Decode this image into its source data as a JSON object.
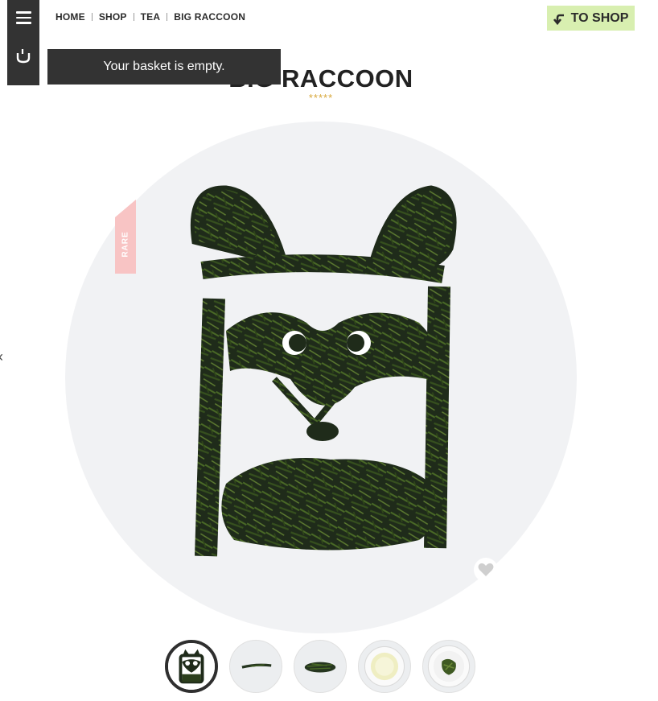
{
  "sidebar": {
    "menu_icon": "hamburger-icon",
    "basket_icon": "cup-icon"
  },
  "basket": {
    "message": "Your basket is empty."
  },
  "breadcrumb": {
    "home": "HOME",
    "shop": "SHOP",
    "tea": "TEA",
    "current": "BIG RACCOON"
  },
  "to_shop": {
    "label": "TO SHOP",
    "icon": "return-arrow-icon",
    "color": "#d8efb0"
  },
  "product": {
    "title": "BIG RACCOON",
    "rating_stars": "*****",
    "rating_color": "#d8a83b",
    "badge": "RARE",
    "badge_color": "#f8c4c4"
  },
  "colors": {
    "sidebar": "#333333",
    "leaf_dark": "#1f2b1a",
    "leaf_mid": "#3f5a23",
    "hero_bg": "#f1f2f4"
  },
  "thumbnails": [
    {
      "name": "raccoon-art"
    },
    {
      "name": "single-leaf"
    },
    {
      "name": "leaf-pile"
    },
    {
      "name": "brewed-cup"
    },
    {
      "name": "wet-leaves"
    }
  ]
}
